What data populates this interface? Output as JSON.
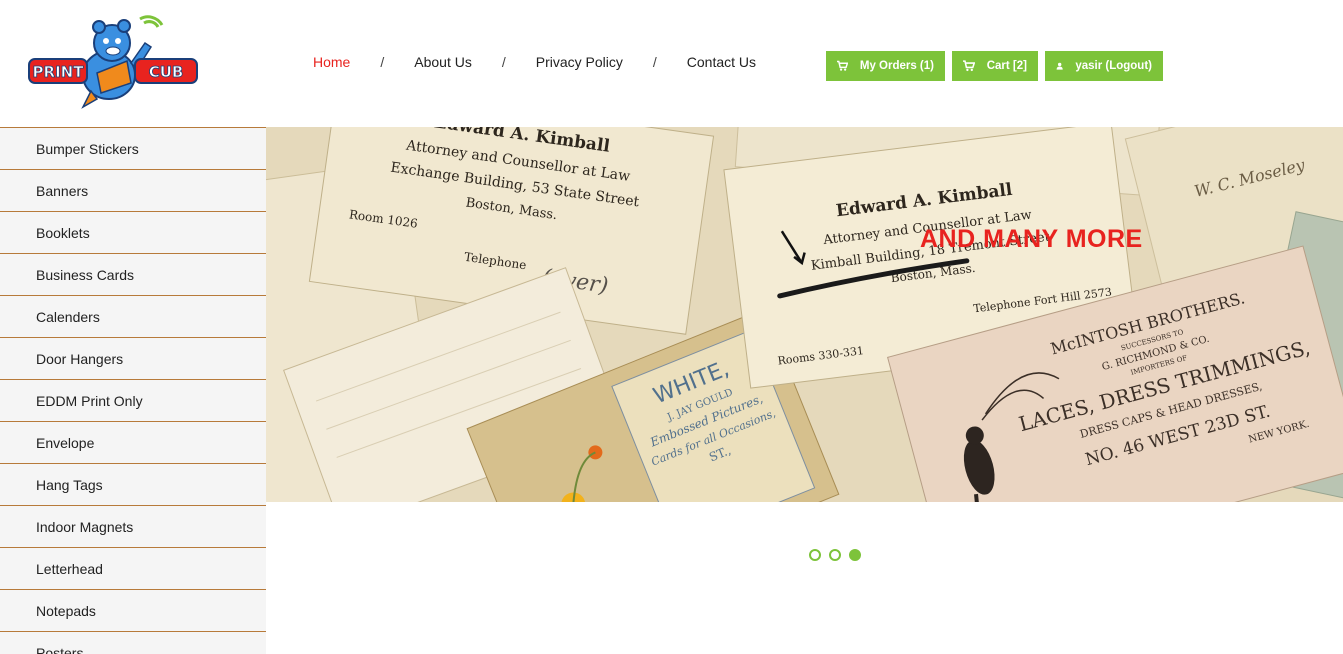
{
  "logo": {
    "text_left": "PRINT",
    "text_right": "CUB"
  },
  "nav": {
    "home": "Home",
    "about": "About Us",
    "privacy": "Privacy Policy",
    "contact": "Contact Us",
    "separator": "/"
  },
  "buttons": {
    "orders": "My Orders (1)",
    "cart": "Cart [2]",
    "user": "yasir (Logout)"
  },
  "sidebar": {
    "items": [
      "Bumper Stickers",
      "Banners",
      "Booklets",
      "Business Cards",
      "Calenders",
      "Door Hangers",
      "EDDM Print Only",
      "Envelope",
      "Hang Tags",
      "Indoor Magnets",
      "Letterhead",
      "Notepads",
      "Posters"
    ]
  },
  "slider": {
    "caption": "AND MANY MORE",
    "active_slide": 3,
    "slide_count": 3,
    "cards": {
      "kimball_back": [
        "Edward A. Kimball",
        "Attorney and Counsellor at Law",
        "Exchange Building, 53 State Street",
        "Boston, Mass.",
        "Room 1026",
        "Telephone",
        "(over)"
      ],
      "kimball_front": [
        "Edward A. Kimball",
        "Attorney and Counsellor at Law",
        "Kimball Building, 18 Tremont Street",
        "Boston, Mass.",
        "Telephone Fort Hill 2573",
        "Rooms 330-331"
      ],
      "mcintosh": [
        "McINTOSH BROTHERS.",
        "SUCCESSORS TO",
        "G. RICHMOND & CO.",
        "IMPORTERS OF",
        "LACES, DRESS TRIMMINGS,",
        "DRESS CAPS & HEAD DRESSES,",
        "NO. 46 WEST 23D ST.",
        "NEW YORK."
      ],
      "white": [
        "WHITE,",
        "J. JAY GOULD",
        "Embossed Pictures,",
        "Cards for all Occasions,",
        "ST.,"
      ],
      "moseley": "W. C. Moseley"
    }
  },
  "colors": {
    "accent_green": "#7dc33a",
    "accent_red": "#e8231f",
    "sidebar_border": "#b77a3a"
  }
}
